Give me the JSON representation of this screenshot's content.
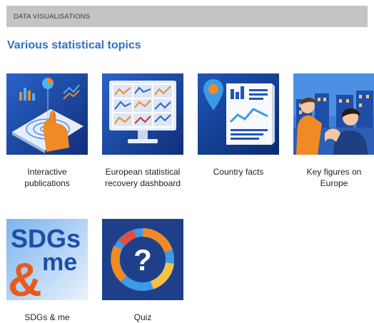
{
  "header": {
    "label": "DATA VISUALISATIONS"
  },
  "section": {
    "title": "Various statistical topics"
  },
  "tiles": [
    {
      "caption": "Interactive publications",
      "icon": "interactive-publications-icon"
    },
    {
      "caption": "European statistical recovery dashboard",
      "icon": "recovery-dashboard-icon"
    },
    {
      "caption": "Country facts",
      "icon": "country-facts-icon"
    },
    {
      "caption": "Key figures on Europe",
      "icon": "key-figures-icon"
    },
    {
      "caption": "SDGs & me",
      "icon": "sdgs-me-icon",
      "image_text": {
        "line1": "SDGs",
        "line2": "me",
        "amp": "&"
      }
    },
    {
      "caption": "Quiz",
      "icon": "quiz-icon",
      "image_text": {
        "mark": "?"
      }
    }
  ],
  "colors": {
    "title": "#2f6fc8",
    "header_bg": "#c4c4c4",
    "tile_blue": "#1f4ea8",
    "orange": "#f08a24"
  }
}
